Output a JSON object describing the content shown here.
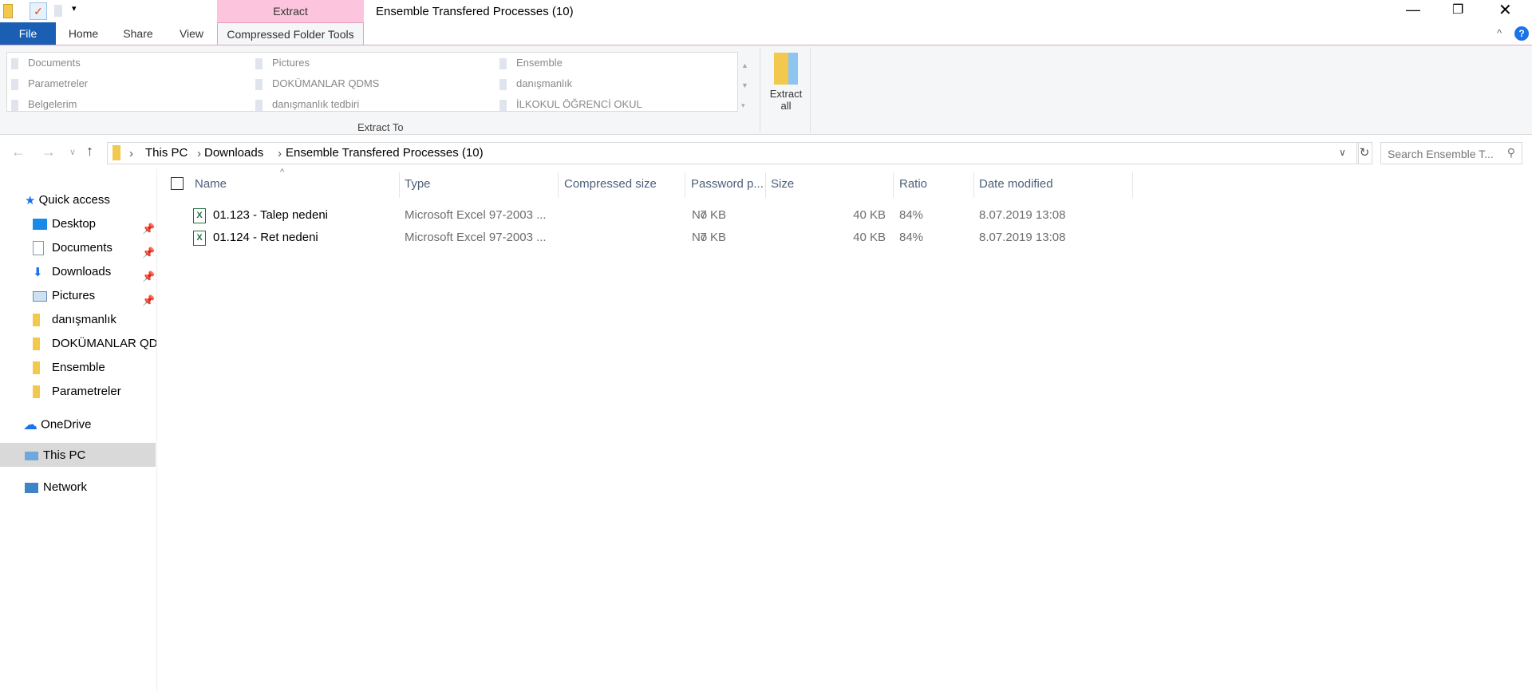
{
  "window": {
    "title": "Ensemble Transfered Processes (10)",
    "context_tab": "Extract"
  },
  "tabs": {
    "file": "File",
    "home": "Home",
    "share": "Share",
    "view": "View",
    "compressed": "Compressed Folder Tools"
  },
  "ribbon": {
    "gallery": [
      [
        "Documents",
        "Pictures",
        "Ensemble"
      ],
      [
        "Parametreler",
        "DOKÜMANLAR QDMS",
        "danışmanlık"
      ],
      [
        "Belgelerim",
        "danışmanlık tedbiri",
        "İLKOKUL ÖĞRENCİ OKUL"
      ]
    ],
    "group_label": "Extract To",
    "extract_all": [
      "Extract",
      "all"
    ]
  },
  "address": {
    "crumbs": [
      "This PC",
      "Downloads",
      "Ensemble Transfered Processes (10)"
    ],
    "search_placeholder": "Search Ensemble T..."
  },
  "sidebar": {
    "quick_access": "Quick access",
    "items": [
      "Desktop",
      "Documents",
      "Downloads",
      "Pictures",
      "danışmanlık",
      "DOKÜMANLAR QDMS",
      "Ensemble",
      "Parametreler"
    ],
    "onedrive": "OneDrive",
    "thispc": "This PC",
    "network": "Network"
  },
  "columns": [
    "Name",
    "Type",
    "Compressed size",
    "Password p...",
    "Size",
    "Ratio",
    "Date modified"
  ],
  "files": [
    {
      "name": "01.123 - Talep nedeni",
      "type": "Microsoft Excel 97-2003 ...",
      "compressed": "7 KB",
      "password": "No",
      "size": "40 KB",
      "ratio": "84%",
      "date": "8.07.2019 13:08"
    },
    {
      "name": "01.124 - Ret nedeni",
      "type": "Microsoft Excel 97-2003 ...",
      "compressed": "7 KB",
      "password": "No",
      "size": "40 KB",
      "ratio": "84%",
      "date": "8.07.2019 13:08"
    }
  ]
}
